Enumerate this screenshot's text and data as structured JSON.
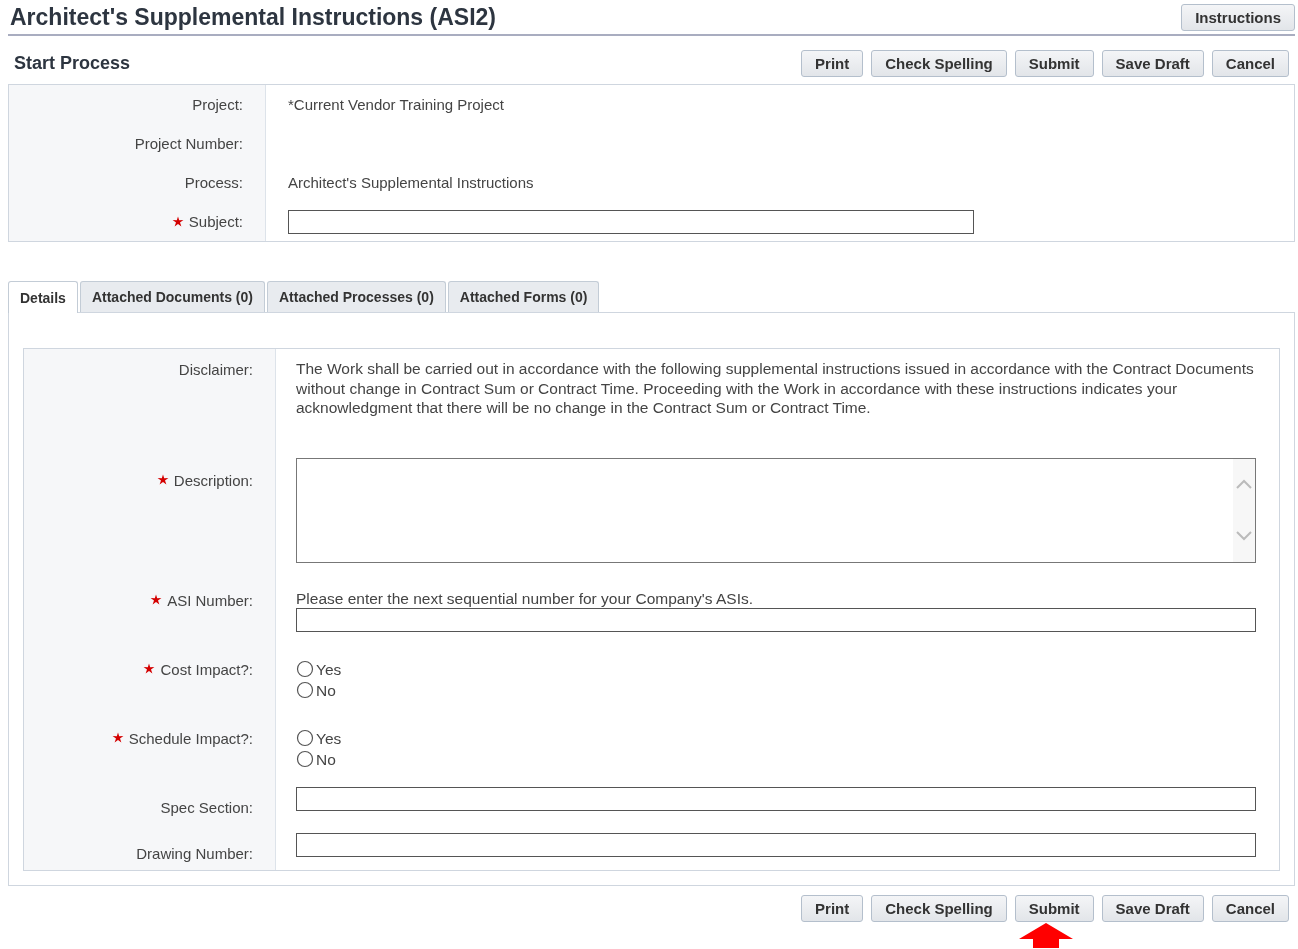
{
  "title": "Architect's Supplemental Instructions (ASI2)",
  "header_buttons": [
    "Instructions"
  ],
  "section_title": "Start Process",
  "top_buttons": [
    "Print",
    "Check Spelling",
    "Submit",
    "Save Draft",
    "Cancel"
  ],
  "project_fields": [
    {
      "label": "Project:",
      "kind": "text",
      "required": false,
      "value": "*Current Vendor Training Project"
    },
    {
      "label": "Project Number:",
      "kind": "text",
      "required": false
    },
    {
      "label": "Process:",
      "kind": "text",
      "required": false,
      "value": "Architect's Supplemental Instructions"
    },
    {
      "label": "Subject:",
      "kind": "input",
      "required": true
    }
  ],
  "tabs": [
    {
      "label": "Details",
      "selected": true
    },
    {
      "label": "Attached Documents (0)",
      "selected": false
    },
    {
      "label": "Attached Processes (0)",
      "selected": false
    },
    {
      "label": "Attached Forms (0)",
      "selected": false
    }
  ],
  "detail_fields": [
    {
      "label": "Disclaimer:",
      "kind": "text",
      "required": false,
      "value": "The Work shall be carried out in accordance with the following supplemental instructions issued in accordance with the Contract Documents without change in Contract Sum or Contract Time. Proceeding with the Work in accordance with these instructions indicates your acknowledgment that there will be no change in the Contract Sum or Contract Time."
    },
    {
      "label": "Description:",
      "kind": "textarea",
      "required": true
    },
    {
      "label": "ASI Number:",
      "kind": "input",
      "required": true,
      "hint": "Please enter the next sequential number for your Company's ASIs."
    },
    {
      "label": "Cost Impact?:",
      "kind": "radio",
      "required": true,
      "options": [
        {
          "label": "Yes",
          "selected": false
        },
        {
          "label": "No",
          "selected": false
        }
      ]
    },
    {
      "label": "Schedule Impact?:",
      "kind": "radio",
      "required": true,
      "options": [
        {
          "label": "Yes",
          "selected": false
        },
        {
          "label": "No",
          "selected": false
        }
      ]
    },
    {
      "label": "Spec Section:",
      "kind": "input",
      "required": false
    },
    {
      "label": "Drawing Number:",
      "kind": "input",
      "required": false
    }
  ],
  "bottom_buttons": [
    "Print",
    "Check Spelling",
    "Submit",
    "Save Draft",
    "Cancel"
  ]
}
